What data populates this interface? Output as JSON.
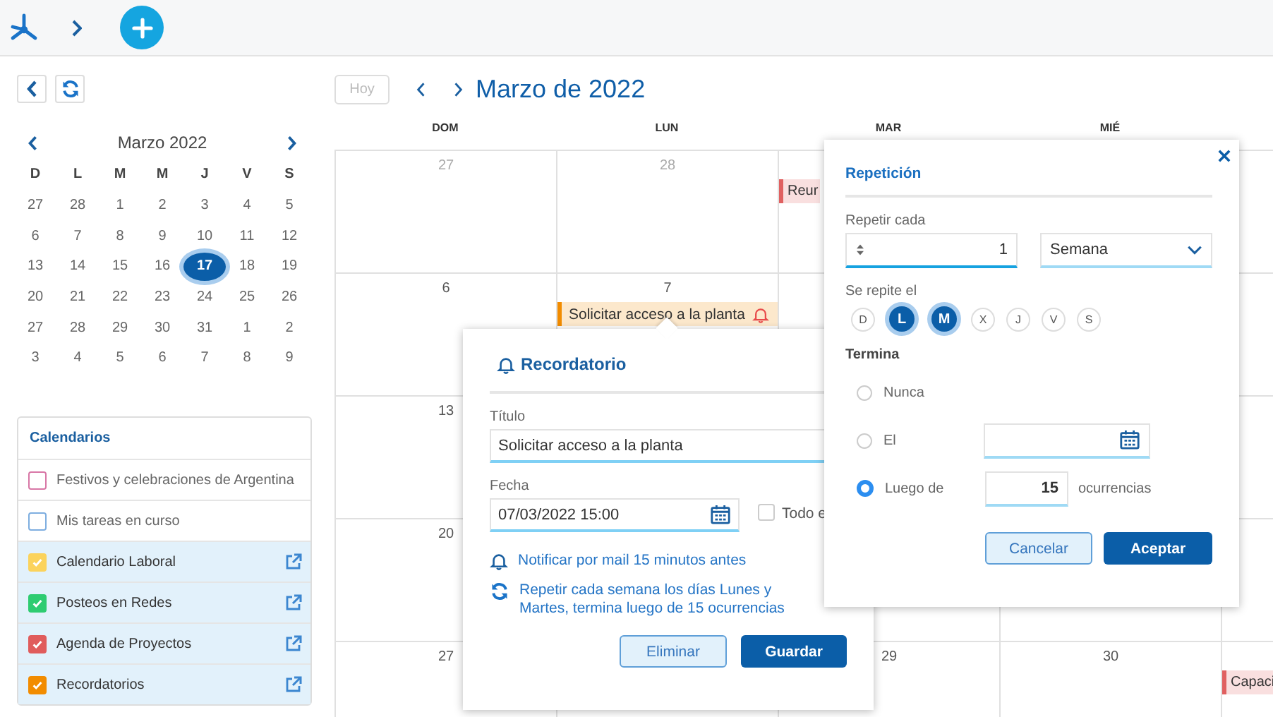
{
  "sidebar": {
    "mini_calendar": {
      "title": "Marzo 2022",
      "weekdays": [
        "D",
        "L",
        "M",
        "M",
        "J",
        "V",
        "S"
      ],
      "weeks": [
        [
          {
            "day": "27",
            "selected": false
          },
          {
            "day": "28",
            "selected": false
          },
          {
            "day": "1",
            "selected": false
          },
          {
            "day": "2",
            "selected": false
          },
          {
            "day": "3",
            "selected": false
          },
          {
            "day": "4",
            "selected": false
          },
          {
            "day": "5",
            "selected": false
          }
        ],
        [
          {
            "day": "6",
            "selected": false
          },
          {
            "day": "7",
            "selected": false
          },
          {
            "day": "8",
            "selected": false
          },
          {
            "day": "9",
            "selected": false
          },
          {
            "day": "10",
            "selected": false
          },
          {
            "day": "11",
            "selected": false
          },
          {
            "day": "12",
            "selected": false
          }
        ],
        [
          {
            "day": "13",
            "selected": false
          },
          {
            "day": "14",
            "selected": false
          },
          {
            "day": "15",
            "selected": false
          },
          {
            "day": "16",
            "selected": false
          },
          {
            "day": "17",
            "selected": true
          },
          {
            "day": "18",
            "selected": false
          },
          {
            "day": "19",
            "selected": false
          }
        ],
        [
          {
            "day": "20",
            "selected": false
          },
          {
            "day": "21",
            "selected": false
          },
          {
            "day": "22",
            "selected": false
          },
          {
            "day": "23",
            "selected": false
          },
          {
            "day": "24",
            "selected": false
          },
          {
            "day": "25",
            "selected": false
          },
          {
            "day": "26",
            "selected": false
          }
        ],
        [
          {
            "day": "27",
            "selected": false
          },
          {
            "day": "28",
            "selected": false
          },
          {
            "day": "29",
            "selected": false
          },
          {
            "day": "30",
            "selected": false
          },
          {
            "day": "31",
            "selected": false
          },
          {
            "day": "1",
            "selected": false
          },
          {
            "day": "2",
            "selected": false
          }
        ],
        [
          {
            "day": "3",
            "selected": false
          },
          {
            "day": "4",
            "selected": false
          },
          {
            "day": "5",
            "selected": false
          },
          {
            "day": "6",
            "selected": false
          },
          {
            "day": "7",
            "selected": false
          },
          {
            "day": "8",
            "selected": false
          },
          {
            "day": "9",
            "selected": false
          }
        ]
      ]
    },
    "calendars": {
      "title": "Calendarios",
      "items": [
        {
          "label": "Festivos y celebraciones de Argentina",
          "checked": false,
          "color": "#d877a6"
        },
        {
          "label": "Mis tareas en curso",
          "checked": false,
          "color": "#7eaee0"
        },
        {
          "label": "Calendario Laboral",
          "checked": true,
          "color": "#fbd35c"
        },
        {
          "label": "Posteos en Redes",
          "checked": true,
          "color": "#2ecc71"
        },
        {
          "label": "Agenda de Proyectos",
          "checked": true,
          "color": "#e05c5c"
        },
        {
          "label": "Recordatorios",
          "checked": true,
          "color": "#f28c00"
        }
      ]
    }
  },
  "calendar": {
    "today_button": "Hoy",
    "title": "Marzo de 2022",
    "columns": [
      "DOM",
      "LUN",
      "MAR",
      "MIÉ"
    ],
    "weeks": [
      {
        "cells": [
          {
            "date": "27",
            "muted": true
          },
          {
            "date": "28",
            "muted": true
          },
          {
            "events": [
              {
                "title": "Reur",
                "color": "#e06060"
              }
            ]
          },
          {},
          {}
        ]
      },
      {
        "cells": [
          {
            "date": "6",
            "muted": false
          },
          {
            "date": "7",
            "muted": false,
            "events": [
              {
                "title": "Solicitar acceso a la planta",
                "color": "#f28c00",
                "reminder": true
              }
            ]
          },
          {},
          {},
          {}
        ]
      },
      {
        "cells": [
          {
            "date": "13",
            "muted": false
          },
          {},
          {},
          {},
          {}
        ]
      },
      {
        "cells": [
          {
            "date": "20",
            "muted": false
          },
          {},
          {},
          {},
          {}
        ]
      },
      {
        "cells": [
          {
            "date": "27",
            "muted": false
          },
          {},
          {
            "date": "29",
            "muted": false
          },
          {
            "date": "30",
            "muted": false
          },
          {
            "events": [
              {
                "title": "Capaci",
                "color": "#e06060"
              }
            ]
          }
        ]
      }
    ]
  },
  "reminder_popup": {
    "title": "Recordatorio",
    "title_label": "Título",
    "title_value": "Solicitar acceso a la planta",
    "date_label": "Fecha",
    "date_value": "07/03/2022 15:00",
    "all_day": {
      "label": "Todo e",
      "checked": false
    },
    "notification": "Notificar por mail 15 minutos antes",
    "repeat_summary": "Repetir cada semana los días Lunes y Martes, termina luego de 15 ocurrencias",
    "buttons": [
      "Eliminar",
      "Guardar"
    ]
  },
  "repeat_dialog": {
    "title": "Repetición",
    "repeat_label": "Repetir cada",
    "interval": "1",
    "unit": "Semana",
    "days_label": "Se repite el",
    "days": [
      {
        "label": "D",
        "selected": false
      },
      {
        "label": "L",
        "selected": true
      },
      {
        "label": "M",
        "selected": true
      },
      {
        "label": "X",
        "selected": false
      },
      {
        "label": "J",
        "selected": false
      },
      {
        "label": "V",
        "selected": false
      },
      {
        "label": "S",
        "selected": false
      }
    ],
    "ends_label": "Termina",
    "end_options": [
      {
        "kind": "plain",
        "label": "Nunca",
        "selected": false
      },
      {
        "kind": "date",
        "label": "El",
        "selected": false
      },
      {
        "kind": "count",
        "label": "Luego de",
        "selected": true,
        "value": "15",
        "suffix": "ocurrencias"
      }
    ],
    "buttons": [
      "Cancelar",
      "Aceptar"
    ]
  }
}
